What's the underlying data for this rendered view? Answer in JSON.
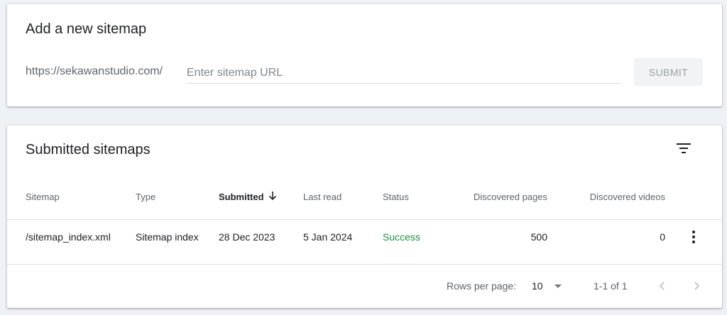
{
  "add_sitemap": {
    "title": "Add a new sitemap",
    "url_prefix": "https://sekawanstudio.com/",
    "input_placeholder": "Enter sitemap URL",
    "input_value": "",
    "submit_label": "SUBMIT"
  },
  "submitted_sitemaps": {
    "title": "Submitted sitemaps",
    "columns": {
      "sitemap": "Sitemap",
      "type": "Type",
      "submitted": "Submitted",
      "last_read": "Last read",
      "status": "Status",
      "discovered_pages": "Discovered pages",
      "discovered_videos": "Discovered videos"
    },
    "sort_column": "Submitted",
    "rows": [
      {
        "sitemap": "/sitemap_index.xml",
        "type": "Sitemap index",
        "submitted": "28 Dec 2023",
        "last_read": "5 Jan 2024",
        "status": "Success",
        "discovered_pages": "500",
        "discovered_videos": "0"
      }
    ],
    "pagination": {
      "rows_per_page_label": "Rows per page:",
      "rows_per_page_value": "10",
      "range": "1-1 of 1"
    }
  },
  "icons": {
    "filter": "filter-list-icon",
    "sort": "arrow-downward-icon",
    "more": "more-vert-icon",
    "prev": "chevron-left-icon",
    "next": "chevron-right-icon",
    "dropdown": "arrow-drop-down-icon"
  },
  "colors": {
    "background": "#eef2f7",
    "card": "#ffffff",
    "success": "#1e8e3e",
    "muted_text": "#5f6368",
    "submit_bg": "#f1f3f4",
    "submit_text": "#9aa0a6"
  }
}
